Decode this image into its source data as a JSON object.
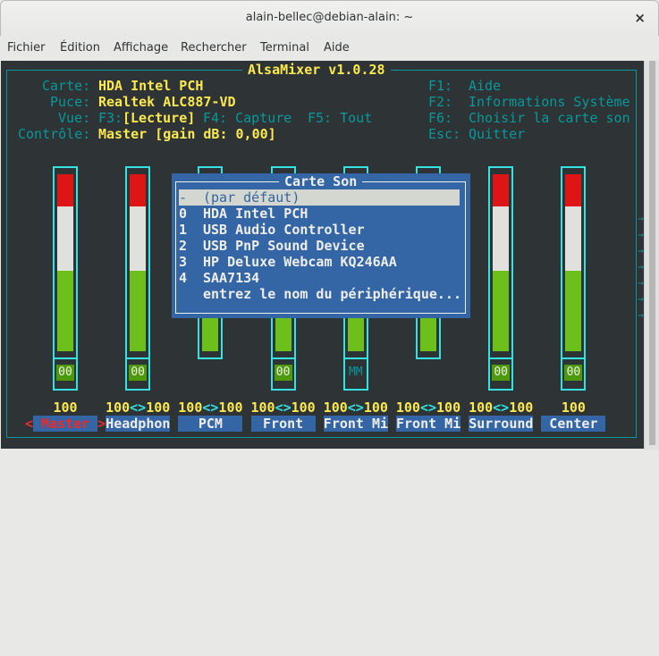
{
  "window": {
    "title": "alain-bellec@debian-alain: ~",
    "close": "×"
  },
  "menu": [
    "Fichier",
    "Édition",
    "Affichage",
    "Rechercher",
    "Terminal",
    "Aide"
  ],
  "app": {
    "title": "AlsaMixer v1.0.28",
    "info": [
      {
        "label": "Carte:",
        "value": "HDA Intel PCH"
      },
      {
        "label": "Puce:",
        "value": "Realtek ALC887-VD"
      },
      {
        "label": "Vue:",
        "f3": "F3:",
        "view": "[Lecture]",
        "f4": "F4: Capture",
        "f5": "F5: Tout"
      },
      {
        "label": "Contrôle:",
        "value": "Master [gain dB: 0,00]"
      }
    ],
    "keys": [
      {
        "key": "F1:",
        "action": "Aide"
      },
      {
        "key": "F2:",
        "action": "Informations Système"
      },
      {
        "key": "F6:",
        "action": "Choisir la carte son"
      },
      {
        "key": "Esc:",
        "action": "Quitter"
      }
    ]
  },
  "channels": [
    {
      "name": "Master",
      "value": "100",
      "foot": "00",
      "selected": true
    },
    {
      "name": "Headphon",
      "left": "100",
      "sep": "<>",
      "right": "100",
      "foot": "00"
    },
    {
      "name": "PCM",
      "left": "100",
      "sep": "<>",
      "right": "100",
      "foot": ""
    },
    {
      "name": "Front",
      "left": "100",
      "sep": "<>",
      "right": "100",
      "foot": "00"
    },
    {
      "name": "Front Mi",
      "left": "100",
      "sep": "<>",
      "right": "100",
      "foot": "MM"
    },
    {
      "name": "Front Mi",
      "left": "100",
      "sep": "<>",
      "right": "100",
      "foot": ""
    },
    {
      "name": "Surround",
      "left": "100",
      "sep": "<>",
      "right": "100",
      "foot": "00"
    },
    {
      "name": "Center",
      "value": "100",
      "foot": "00"
    }
  ],
  "selection_marks": {
    "left": "<",
    "right": ">"
  },
  "popup": {
    "title": "Carte Son",
    "items": [
      {
        "idx": "-",
        "name": "(par défaut)",
        "highlighted": true
      },
      {
        "idx": "0",
        "name": "HDA Intel PCH"
      },
      {
        "idx": "1",
        "name": "USB Audio Controller"
      },
      {
        "idx": "2",
        "name": "USB PnP Sound Device"
      },
      {
        "idx": "3",
        "name": "HP Deluxe Webcam KQ246AA"
      },
      {
        "idx": "4",
        "name": "SAA7134"
      },
      {
        "idx": "",
        "name": "entrez le nom du périphérique..."
      }
    ]
  },
  "colors": {
    "bg": "#2e3436",
    "accent": "#34e2e2",
    "popup": "#3465a4",
    "text": "#fce94f"
  }
}
